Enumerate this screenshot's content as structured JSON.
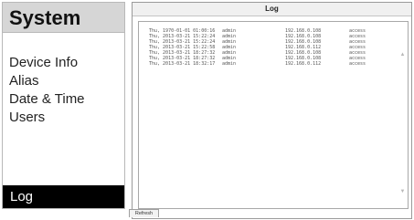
{
  "sidebar": {
    "title": "System",
    "items": [
      {
        "label": "Device Info"
      },
      {
        "label": "Alias"
      },
      {
        "label": "Date & Time"
      },
      {
        "label": "Users"
      }
    ],
    "active_item": {
      "label": "Log"
    }
  },
  "log_window": {
    "title": "Log",
    "entries": [
      {
        "date": "Thu, 1970-01-01 01:00:16",
        "user": "admin",
        "ip": "192.168.0.108",
        "action": "access"
      },
      {
        "date": "Thu, 2013-03-21 15:22:24",
        "user": "admin",
        "ip": "192.168.0.108",
        "action": "access"
      },
      {
        "date": "Thu, 2013-03-21 15:22:24",
        "user": "admin",
        "ip": "192.168.0.108",
        "action": "access"
      },
      {
        "date": "Thu, 2013-03-21 15:22:58",
        "user": "admin",
        "ip": "192.168.0.112",
        "action": "access"
      },
      {
        "date": "Thu, 2013-03-21 18:27:32",
        "user": "admin",
        "ip": "192.168.0.108",
        "action": "access"
      },
      {
        "date": "Thu, 2013-03-21 18:27:32",
        "user": "admin",
        "ip": "192.168.0.108",
        "action": "access"
      },
      {
        "date": "Thu, 2013-03-21 18:32:17",
        "user": "admin",
        "ip": "192.168.0.112",
        "action": "access"
      }
    ],
    "refresh_label": "Refresh"
  },
  "icons": {
    "scroll_up": "chevron-up-icon",
    "scroll_down": "chevron-down-icon"
  },
  "colors": {
    "sidebar_header_bg": "#d6d6d6",
    "active_nav_bg": "#000000",
    "active_nav_text": "#ffffff"
  }
}
